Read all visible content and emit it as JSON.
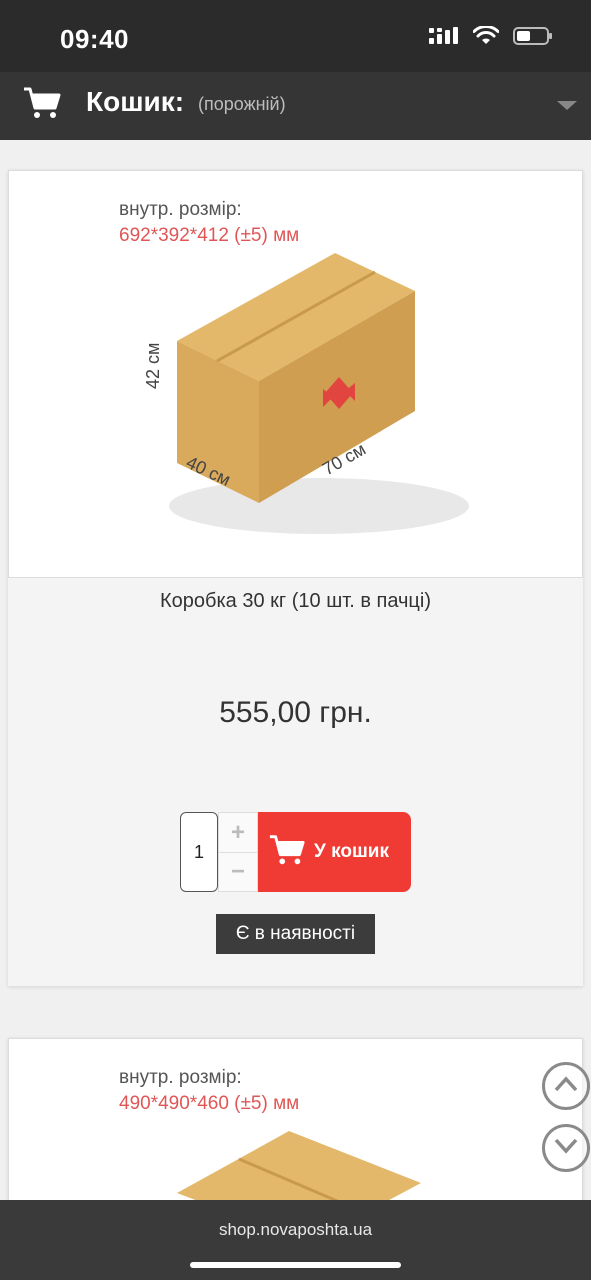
{
  "status_bar": {
    "time": "09:40"
  },
  "cart_header": {
    "title": "Кошик:",
    "status": "(порожній)"
  },
  "products": [
    {
      "size_label": "внутр. розмір:",
      "size_value": "692*392*412 (±5) мм",
      "dim_height": "42 см",
      "dim_width": "40 см",
      "dim_length": "70 см",
      "title": "Коробка 30 кг (10 шт. в пачці)",
      "price": "555,00 грн.",
      "quantity": "1",
      "qty_plus": "+",
      "qty_minus": "−",
      "add_to_cart": "У кошик",
      "stock": "Є в наявності"
    },
    {
      "size_label": "внутр. розмір:",
      "size_value": "490*490*460 (±5) мм"
    }
  ],
  "url_bar": {
    "url": "shop.novaposhta.ua"
  },
  "colors": {
    "accent": "#ef3b33",
    "header_bg": "#353535",
    "size_value": "#e05656"
  }
}
